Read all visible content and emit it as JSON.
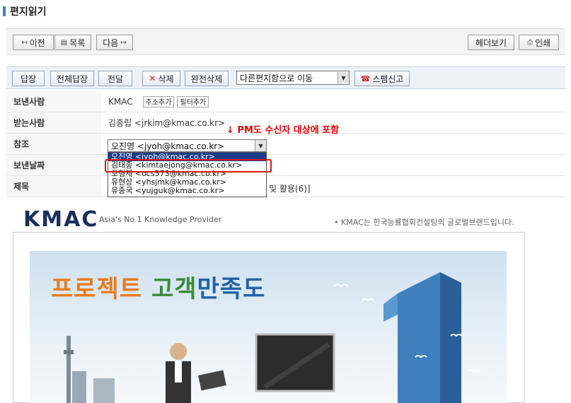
{
  "page": {
    "title": "편지읽기"
  },
  "toolbar_top": {
    "prev": "이전",
    "list": "목록",
    "next": "다음",
    "header_view": "헤더보기",
    "print": "인쇄"
  },
  "toolbar_actions": {
    "reply": "답장",
    "reply_all": "전체답장",
    "forward": "전달",
    "delete": "삭제",
    "delete_permanent": "완전삭제",
    "move_select": "다른편지함으로 이동",
    "spam_report": "스팸신고"
  },
  "fields": {
    "from_label": "보낸사람",
    "from_value": "KMAC",
    "add_address": "주소추가",
    "add_filter": "필터추가",
    "to_label": "받는사람",
    "to_value": "김종립 <jrkim@kmac.co.kr>",
    "cc_label": "참조",
    "cc_selected": "오진영 <jyoh@kmac.co.kr>",
    "date_label": "보낸날짜",
    "subject_label": "제목",
    "subject_tail": "및 활용(6)]"
  },
  "cc_options": [
    "오진영 <jyoh@kmac.co.kr>",
    "김태종 <kimtaejong@kmac.co.kr>",
    "오형제 <ocs573@kmac.co.kr>",
    "유현상 <yhsjmk@kmac.co.kr>",
    "유종국 <yujguk@kmac.co.kr>"
  ],
  "annotation": "↓ PM도 수신자 대상에 포함",
  "email_body": {
    "logo": "KMAC",
    "tagline": "Asia's No.1 Knowledge Provider",
    "description": "• KMAC는 한국능률협회컨설팅의 글로벌브랜드입니다.",
    "banner_title_part1": "프로젝트 ",
    "banner_title_part2": "고객",
    "banner_title_part3": "만족도"
  },
  "colors": {
    "accent": "#4a7fb8",
    "annotation_red": "#e60000",
    "highlight_red": "#d91a1a",
    "logo_navy": "#1b2f5e"
  }
}
